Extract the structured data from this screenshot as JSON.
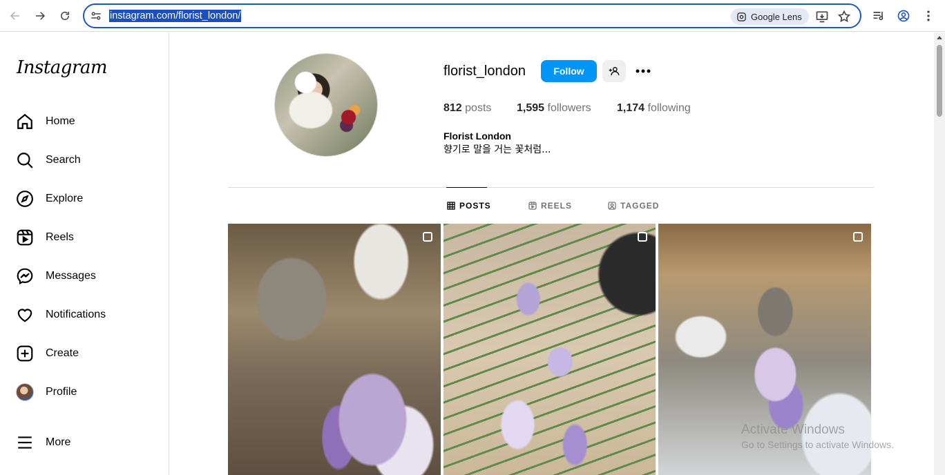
{
  "browser": {
    "url": "instagram.com/florist_london/",
    "lens_label": "Google Lens"
  },
  "sidebar": {
    "logo": "Instagram",
    "items": [
      {
        "label": "Home",
        "icon": "home-icon"
      },
      {
        "label": "Search",
        "icon": "search-icon"
      },
      {
        "label": "Explore",
        "icon": "compass-icon"
      },
      {
        "label": "Reels",
        "icon": "reels-icon"
      },
      {
        "label": "Messages",
        "icon": "messenger-icon"
      },
      {
        "label": "Notifications",
        "icon": "heart-icon"
      },
      {
        "label": "Create",
        "icon": "plus-square-icon"
      },
      {
        "label": "Profile",
        "icon": "avatar"
      },
      {
        "label": "More",
        "icon": "hamburger-icon"
      }
    ]
  },
  "profile": {
    "username": "florist_london",
    "follow_label": "Follow",
    "posts_count": "812",
    "posts_label": "posts",
    "followers_count": "1,595",
    "followers_label": "followers",
    "following_count": "1,174",
    "following_label": "following",
    "full_name": "Florist London",
    "bio": "향기로 말을 거는 꽃처럼..."
  },
  "tabs": [
    {
      "label": "POSTS",
      "active": true
    },
    {
      "label": "REELS",
      "active": false
    },
    {
      "label": "TAGGED",
      "active": false
    }
  ],
  "watermark": {
    "line1": "Activate Windows",
    "line2": "Go to Settings to activate Windows."
  },
  "colors": {
    "accent": "#0095f6",
    "omnibox_border": "#1a56c6"
  }
}
